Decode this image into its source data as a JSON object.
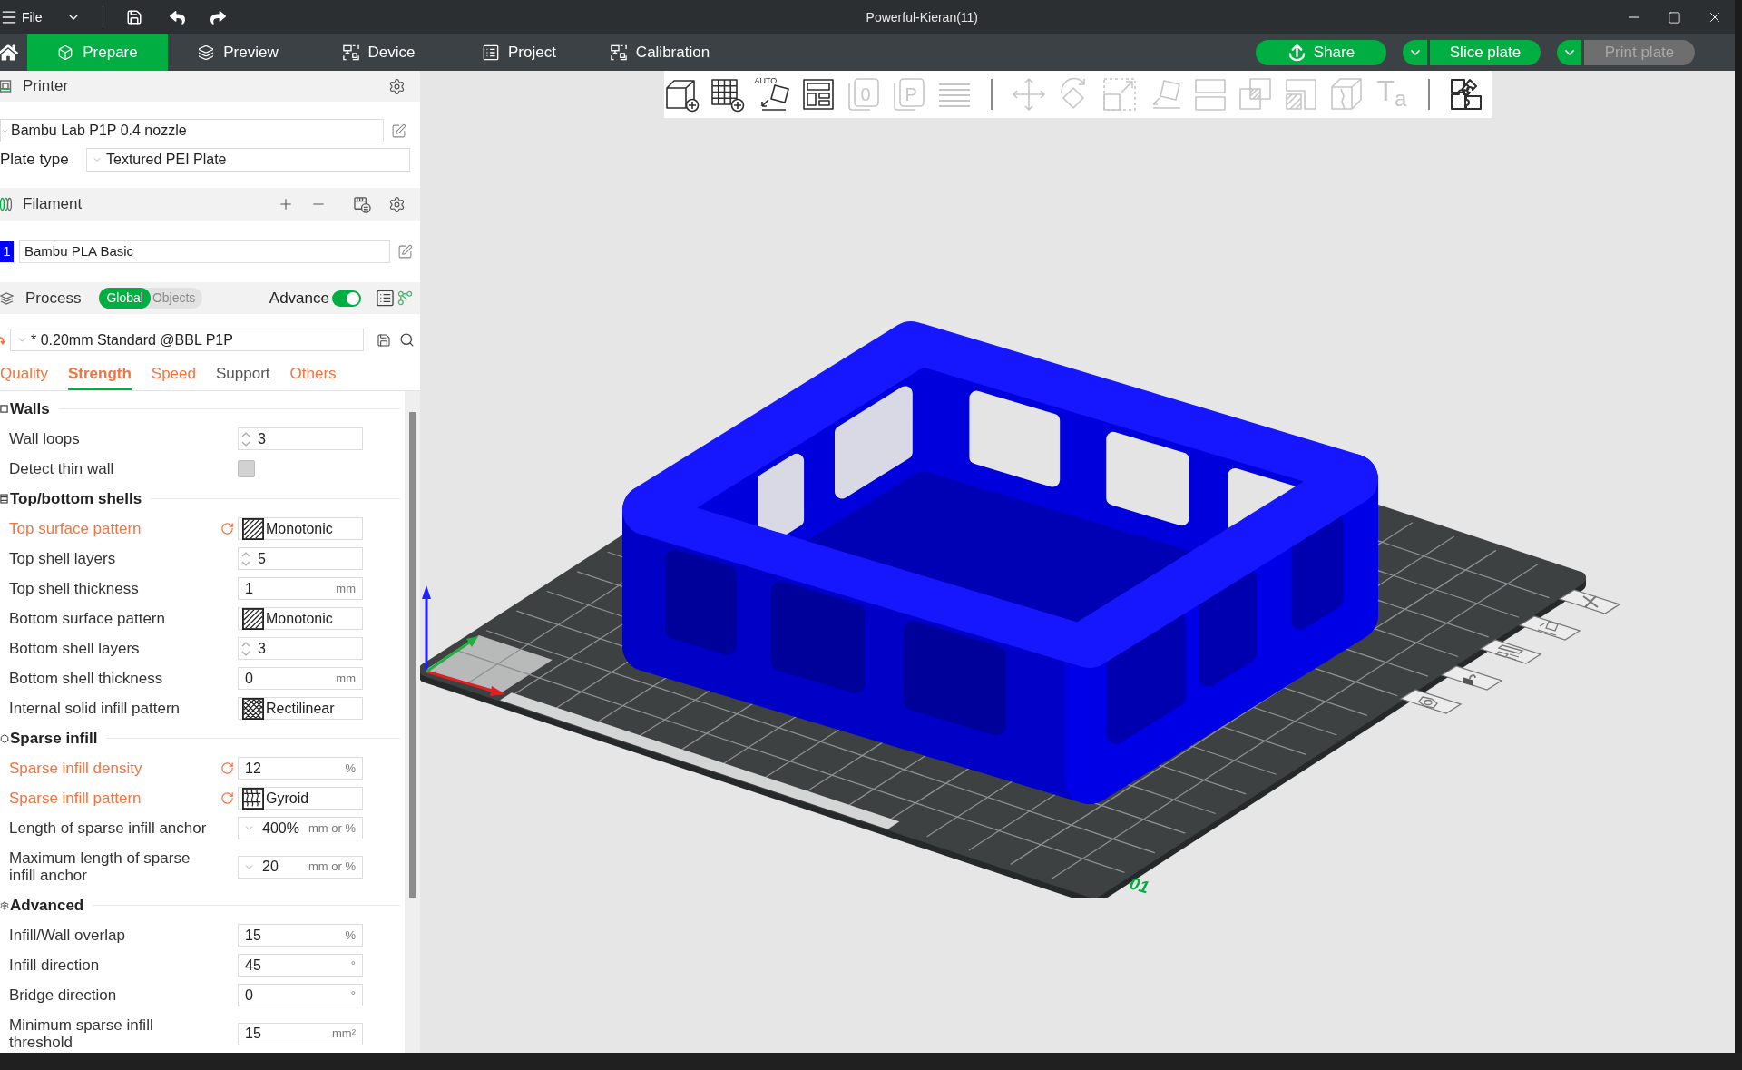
{
  "title_bar": {
    "menu": "File",
    "title": "Powerful-Kieran(11)"
  },
  "main_tabs": [
    {
      "label": "Prepare",
      "selected": true
    },
    {
      "label": "Preview",
      "selected": false
    },
    {
      "label": "Device",
      "selected": false
    },
    {
      "label": "Project",
      "selected": false
    },
    {
      "label": "Calibration",
      "selected": false
    }
  ],
  "actions": [
    {
      "kind": "share",
      "label": "Share",
      "disabled": false
    },
    {
      "kind": "split",
      "label": "Slice plate",
      "disabled": false
    },
    {
      "kind": "split",
      "label": "Print plate",
      "disabled": true
    }
  ],
  "printer": {
    "title": "Printer",
    "preset": "Bambu Lab P1P 0.4 nozzle",
    "plate_type_label": "Plate type",
    "plate_type": "Textured PEI Plate"
  },
  "filament": {
    "title": "Filament",
    "items": [
      {
        "number": "1",
        "color": "#0000ff",
        "name": "Bambu PLA Basic"
      }
    ]
  },
  "process": {
    "title": "Process",
    "scope": [
      {
        "label": "Global",
        "selected": true
      },
      {
        "label": "Objects",
        "selected": false
      }
    ],
    "advance_label": "Advance",
    "advance_on": true,
    "preset": "* 0.20mm Standard @BBL P1P",
    "modified": true
  },
  "setting_tabs": [
    {
      "label": "Quality",
      "selected": false,
      "modified": true
    },
    {
      "label": "Strength",
      "selected": true,
      "modified": true
    },
    {
      "label": "Speed",
      "selected": false,
      "modified": true
    },
    {
      "label": "Support",
      "selected": false,
      "modified": false
    },
    {
      "label": "Others",
      "selected": false,
      "modified": true
    }
  ],
  "sections": [
    {
      "title": "Walls",
      "settings": [
        {
          "kind": "spin",
          "label": "Wall loops",
          "value": "3",
          "modified": false
        },
        {
          "kind": "checkbox",
          "label": "Detect thin wall",
          "checked": false,
          "modified": false
        }
      ]
    },
    {
      "title": "Top/bottom shells",
      "settings": [
        {
          "kind": "pattern",
          "label": "Top surface pattern",
          "value": "Monotonic",
          "modified": true
        },
        {
          "kind": "spin",
          "label": "Top shell layers",
          "value": "5",
          "modified": false
        },
        {
          "kind": "number",
          "label": "Top shell thickness",
          "value": "1",
          "unit": "mm",
          "modified": false
        },
        {
          "kind": "pattern",
          "label": "Bottom surface pattern",
          "value": "Monotonic",
          "modified": false
        },
        {
          "kind": "spin",
          "label": "Bottom shell layers",
          "value": "3",
          "modified": false
        },
        {
          "kind": "number",
          "label": "Bottom shell thickness",
          "value": "0",
          "unit": "mm",
          "modified": false
        },
        {
          "kind": "pattern",
          "label": "Internal solid infill pattern",
          "value": "Rectilinear",
          "modified": false
        }
      ]
    },
    {
      "title": "Sparse infill",
      "settings": [
        {
          "kind": "number",
          "label": "Sparse infill density",
          "value": "12",
          "unit": "%",
          "modified": true
        },
        {
          "kind": "pattern",
          "label": "Sparse infill pattern",
          "value": "Gyroid",
          "modified": true
        },
        {
          "kind": "combo",
          "label": "Length of sparse infill anchor",
          "value": "400%",
          "unit": "mm or %",
          "modified": false
        },
        {
          "kind": "combo",
          "label": "Maximum length of sparse infill anchor",
          "value": "20",
          "unit": "mm or %",
          "modified": false
        }
      ]
    },
    {
      "title": "Advanced",
      "settings": [
        {
          "kind": "number",
          "label": "Infill/Wall overlap",
          "value": "15",
          "unit": "%",
          "modified": false
        },
        {
          "kind": "number",
          "label": "Infill direction",
          "value": "45",
          "unit": "°",
          "modified": false
        },
        {
          "kind": "number",
          "label": "Bridge direction",
          "value": "0",
          "unit": "°",
          "modified": false
        },
        {
          "kind": "number",
          "label": "Minimum sparse infill threshold",
          "value": "15",
          "unit": "mm²",
          "modified": false
        }
      ]
    }
  ],
  "viewport": {
    "toolbar": [
      {
        "items": [
          {
            "disabled": false
          },
          {
            "disabled": false
          },
          {
            "disabled": false,
            "glyph": "AUTO"
          },
          {
            "disabled": false
          },
          {
            "disabled": true,
            "glyph": "0"
          },
          {
            "disabled": true,
            "glyph": "P"
          },
          {
            "disabled": true
          }
        ]
      },
      {
        "items": [
          {
            "disabled": true
          },
          {
            "disabled": true
          },
          {
            "disabled": true
          },
          {
            "disabled": true
          },
          {
            "disabled": true
          },
          {
            "disabled": true
          },
          {
            "disabled": true
          },
          {
            "disabled": true
          },
          {
            "disabled": true,
            "glyph": "T$_{a}$"
          }
        ]
      },
      {
        "items": [
          {
            "disabled": false
          }
        ]
      }
    ],
    "plate_number": "01"
  }
}
